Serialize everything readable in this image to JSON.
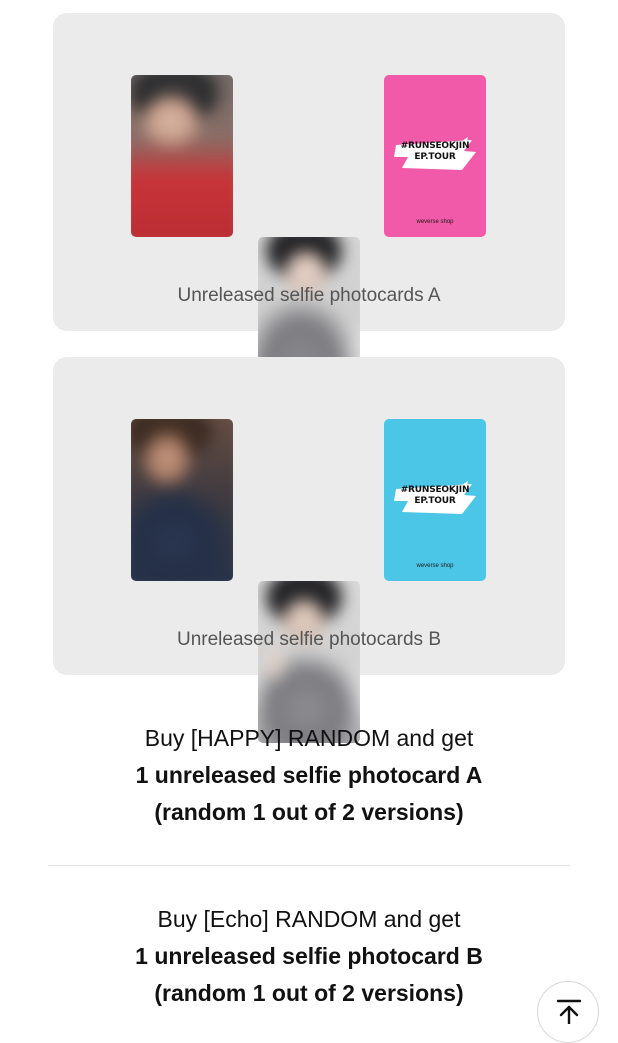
{
  "sections": [
    {
      "caption": "Unreleased selfie photocards A",
      "cards": [
        {
          "kind": "selfie",
          "name": "photocard-a-1"
        },
        {
          "kind": "selfie",
          "name": "photocard-a-2"
        },
        {
          "kind": "brand",
          "color": "#f15aa8",
          "logo_line1": "#RUNSEOKJIN",
          "logo_line2": "EP.TOUR",
          "footer": "weverse shop"
        }
      ]
    },
    {
      "caption": "Unreleased selfie photocards B",
      "cards": [
        {
          "kind": "selfie",
          "name": "photocard-b-1"
        },
        {
          "kind": "selfie",
          "name": "photocard-b-2"
        },
        {
          "kind": "brand",
          "color": "#4cc6e6",
          "logo_line1": "#RUNSEOKJIN",
          "logo_line2": "EP.TOUR",
          "footer": "weverse shop"
        }
      ]
    }
  ],
  "offers": [
    {
      "line1": "Buy [HAPPY] RANDOM and get",
      "line2": "1 unreleased selfie photocard A",
      "line3": "(random 1 out of 2 versions)"
    },
    {
      "line1": "Buy [Echo] RANDOM and get",
      "line2": "1 unreleased selfie photocard B",
      "line3": "(random 1 out of 2 versions)"
    }
  ],
  "scroll_top_button": {
    "icon": "arrow-up-to-top-icon"
  }
}
